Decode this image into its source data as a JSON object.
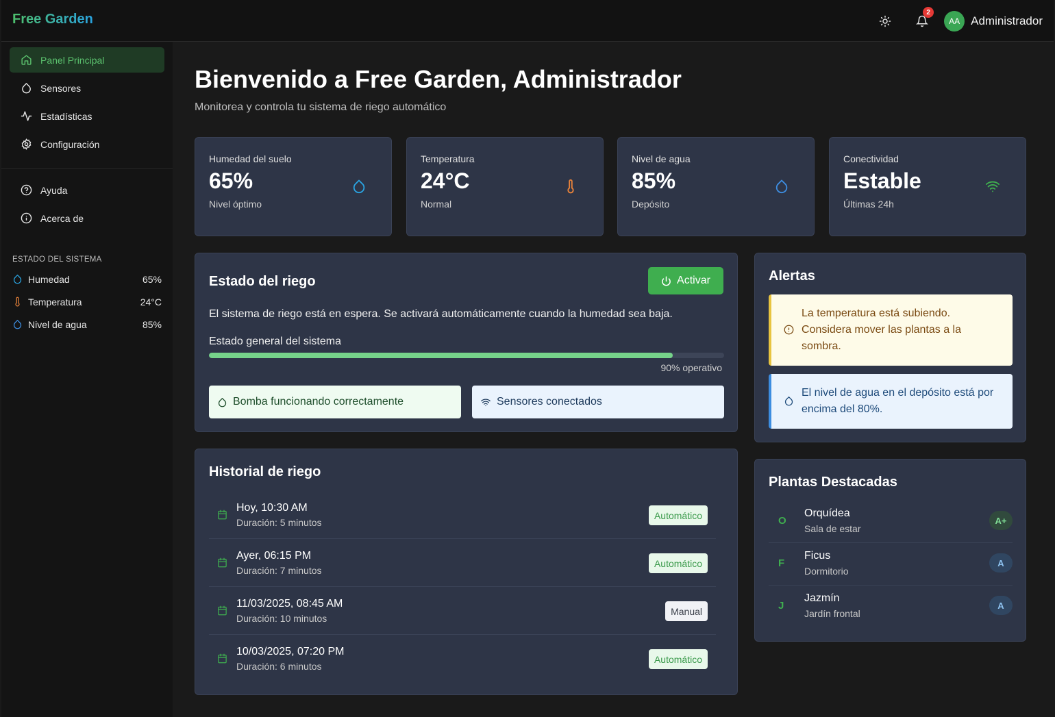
{
  "topbar": {
    "brand": "Free Garden",
    "notifications_count": "2",
    "user_initials": "AA",
    "user_name": "Administrador"
  },
  "sidebar": {
    "items": [
      {
        "label": "Panel Principal",
        "icon": "home-icon"
      },
      {
        "label": "Sensores",
        "icon": "droplet-icon"
      },
      {
        "label": "Estadísticas",
        "icon": "activity-icon"
      },
      {
        "label": "Configuración",
        "icon": "gear-icon"
      }
    ],
    "secondary": [
      {
        "label": "Ayuda",
        "icon": "help-circle-icon"
      },
      {
        "label": "Acerca de",
        "icon": "info-icon"
      }
    ],
    "system_title": "ESTADO DEL SISTEMA",
    "system": [
      {
        "label": "Humedad",
        "value": "65%"
      },
      {
        "label": "Temperatura",
        "value": "24°C"
      },
      {
        "label": "Nivel de agua",
        "value": "85%"
      }
    ]
  },
  "main": {
    "title": "Bienvenido a Free Garden, Administrador",
    "subtitle": "Monitorea y controla tu sistema de riego automático"
  },
  "stats": [
    {
      "label": "Humedad del suelo",
      "value": "65%",
      "sub": "Nivel óptimo",
      "icon": "droplet-icon",
      "color": "#2aa3e0"
    },
    {
      "label": "Temperatura",
      "value": "24°C",
      "sub": "Normal",
      "icon": "thermometer-icon",
      "color": "#e8823a"
    },
    {
      "label": "Nivel de agua",
      "value": "85%",
      "sub": "Depósito",
      "icon": "droplet-icon",
      "color": "#3d8de0"
    },
    {
      "label": "Conectividad",
      "value": "Estable",
      "sub": "Últimas 24h",
      "icon": "wifi-icon",
      "color": "#3fae4f"
    }
  ],
  "riego": {
    "title": "Estado del riego",
    "button": "Activar",
    "description": "El sistema de riego está en espera. Se activará automáticamente cuando la humedad sea baja.",
    "progress_label": "Estado general del sistema",
    "progress_value": 0.9,
    "progress_text": "90% operativo",
    "status_pump": "Bomba funcionando correctamente",
    "status_sensors": "Sensores conectados"
  },
  "alerts": {
    "title": "Alertas",
    "items": [
      {
        "text": "La temperatura está subiendo. Considera mover las plantas a la sombra.",
        "type": "warning"
      },
      {
        "text": "El nivel de agua en el depósito está por encima del 80%.",
        "type": "info"
      }
    ]
  },
  "history": {
    "title": "Historial de riego",
    "rows": [
      {
        "date": "Hoy, 10:30 AM",
        "duration": "Duración: 5 minutos",
        "mode": "Automático"
      },
      {
        "date": "Ayer, 06:15 PM",
        "duration": "Duración: 7 minutos",
        "mode": "Automático"
      },
      {
        "date": "11/03/2025, 08:45 AM",
        "duration": "Duración: 10 minutos",
        "mode": "Manual"
      },
      {
        "date": "10/03/2025, 07:20 PM",
        "duration": "Duración: 6 minutos",
        "mode": "Automático"
      }
    ]
  },
  "plants": {
    "title": "Plantas Destacadas",
    "rows": [
      {
        "initial": "O",
        "name": "Orquídea",
        "location": "Sala de estar",
        "grade": "A+"
      },
      {
        "initial": "F",
        "name": "Ficus",
        "location": "Dormitorio",
        "grade": "A"
      },
      {
        "initial": "J",
        "name": "Jazmín",
        "location": "Jardín frontal",
        "grade": "A"
      }
    ]
  }
}
